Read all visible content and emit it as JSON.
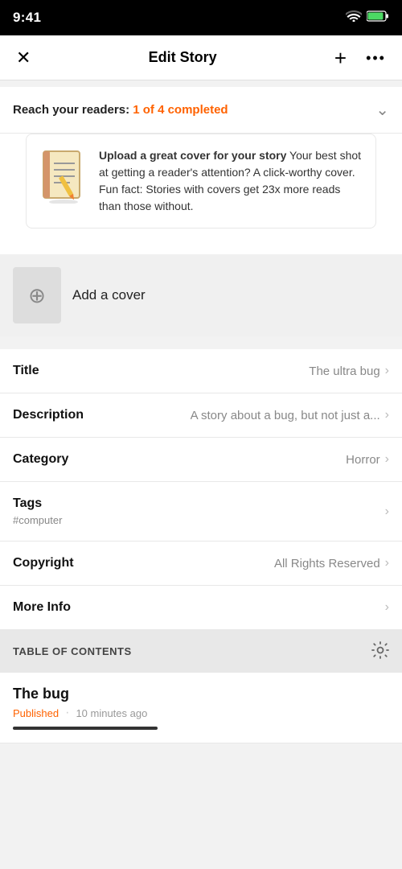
{
  "status_bar": {
    "time": "9:41",
    "wifi_label": "wifi",
    "battery_label": "battery"
  },
  "header": {
    "title": "Edit Story",
    "close_label": "×",
    "add_label": "+",
    "more_label": "···"
  },
  "readers_banner": {
    "prefix": "Reach your readers: ",
    "completed": "1 of 4 completed"
  },
  "tip_card": {
    "title": "Upload a great cover for your story",
    "body": "Your best shot at getting a reader's attention? A click-worthy cover. Fun fact: Stories with covers get 23x more reads than those without."
  },
  "add_cover": {
    "label": "Add a cover"
  },
  "form_rows": [
    {
      "label": "Title",
      "value": "The ultra bug",
      "sub": ""
    },
    {
      "label": "Description",
      "value": "A story about a bug, but not just a...",
      "sub": ""
    },
    {
      "label": "Category",
      "value": "Horror",
      "sub": ""
    },
    {
      "label": "Tags",
      "value": "",
      "sub": "#computer"
    },
    {
      "label": "Copyright",
      "value": "All Rights Reserved",
      "sub": ""
    },
    {
      "label": "More Info",
      "value": "",
      "sub": ""
    }
  ],
  "toc": {
    "title": "TABLE OF CONTENTS",
    "gear_label": "settings"
  },
  "toc_items": [
    {
      "title": "The bug",
      "status": "Published",
      "time": "10 minutes ago"
    }
  ],
  "icons": {
    "chevron": "›",
    "close": "✕",
    "add": "+",
    "more": "•••",
    "plus_circle": "⊕",
    "chevron_down": "⌄"
  }
}
